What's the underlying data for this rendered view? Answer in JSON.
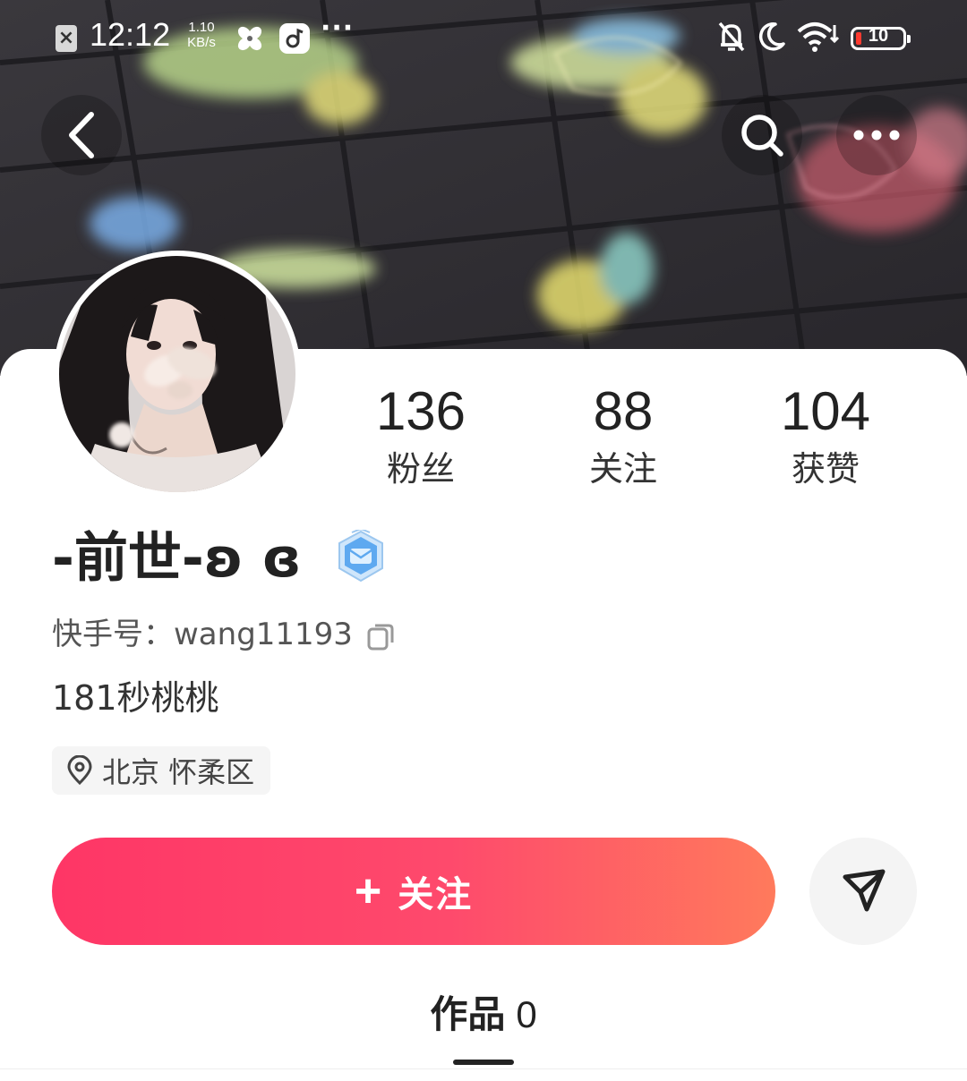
{
  "status_bar": {
    "time": "12:12",
    "speed_value": "1.10",
    "speed_unit": "KB/s",
    "more": "···",
    "battery_level": "10",
    "icons": [
      "close-box-icon",
      "pinwheel-app-icon",
      "music-app-icon",
      "mute-bell-icon",
      "moon-icon",
      "wifi-icon",
      "battery-icon"
    ]
  },
  "nav": {
    "icons": [
      "back-arrow-icon",
      "search-icon",
      "more-dots-icon"
    ]
  },
  "profile": {
    "stats": [
      {
        "value": "136",
        "label": "粉丝"
      },
      {
        "value": "88",
        "label": "关注"
      },
      {
        "value": "104",
        "label": "获赞"
      }
    ],
    "username": "-前世-ʚ ɞ",
    "kuaishou_id": "快手号：wang11193",
    "bio": "181秒桃桃",
    "location": "北京 怀柔区"
  },
  "actions": {
    "follow_plus": "+",
    "follow_label": "关注"
  },
  "tabs": {
    "works_label": "作品",
    "works_count": "0"
  },
  "colors": {
    "accent": "#fe3666",
    "accent_end": "#ff7a5c",
    "battery_low": "#ff3b30",
    "badge_blue": "#5ea9f0"
  }
}
